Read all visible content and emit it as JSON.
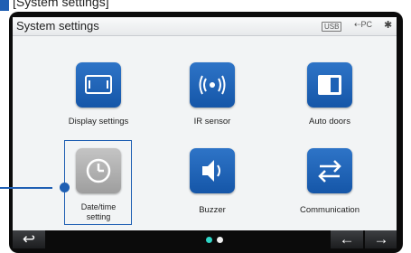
{
  "caption": "[System settings]",
  "screen": {
    "title": "System settings",
    "status": {
      "usb": "USB",
      "pc": "PC"
    }
  },
  "items": [
    {
      "label": "Display settings",
      "icon": "display-icon"
    },
    {
      "label": "IR sensor",
      "icon": "ir-sensor-icon"
    },
    {
      "label": "Auto doors",
      "icon": "auto-doors-icon"
    },
    {
      "label_line1": "Date/time",
      "label_line2": "setting",
      "icon": "clock-icon",
      "selected": true
    },
    {
      "label": "Buzzer",
      "icon": "speaker-icon"
    },
    {
      "label": "Communication",
      "icon": "transfer-arrows-icon"
    }
  ],
  "pager": {
    "pages": 2,
    "current": 1
  },
  "colors": {
    "accent": "#1f5fb3",
    "tile_blue": "#1d62b6",
    "tile_gray": "#aaaaaa",
    "page_dot_active": "#2fd6c7"
  }
}
